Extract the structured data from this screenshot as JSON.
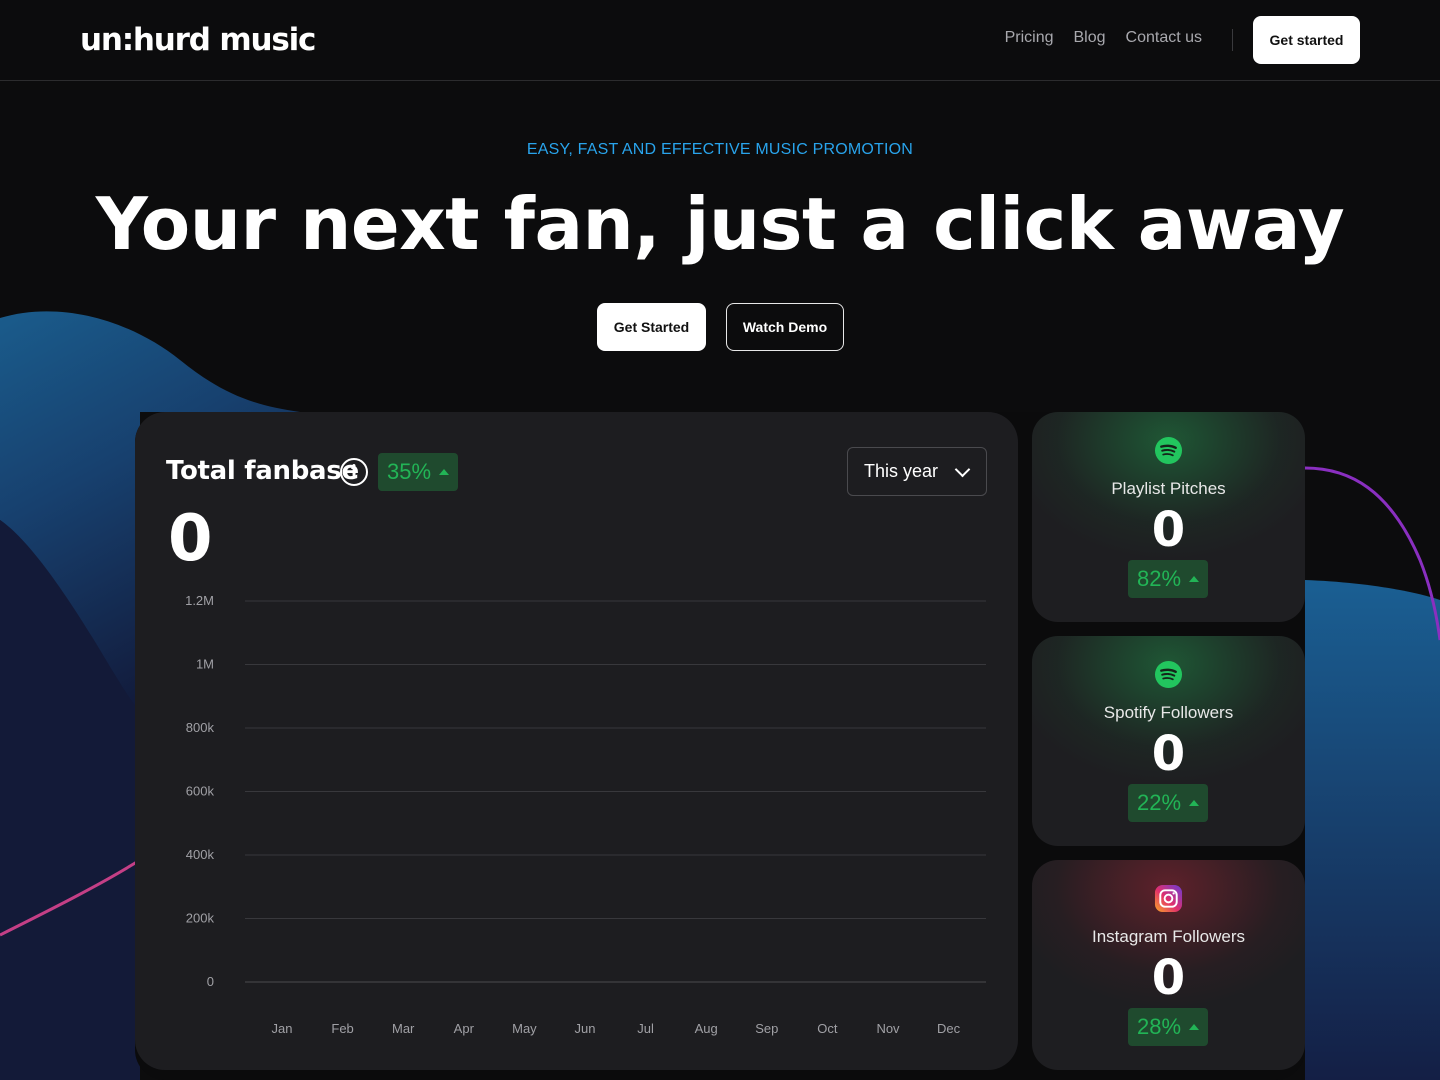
{
  "header": {
    "logo": "un:hurd music",
    "nav": [
      "Pricing",
      "Blog",
      "Contact us"
    ],
    "cta": "Get started"
  },
  "hero": {
    "eyebrow": "EASY, FAST AND EFFECTIVE MUSIC PROMOTION",
    "headline": "Your next fan, just a click away",
    "primary_button": "Get Started",
    "secondary_button": "Watch Demo"
  },
  "fanbase": {
    "title": "Total fanbase",
    "change": "35%",
    "value": "0",
    "period": "This year"
  },
  "chart_data": {
    "type": "line",
    "categories": [
      "Jan",
      "Feb",
      "Mar",
      "Apr",
      "May",
      "Jun",
      "Jul",
      "Aug",
      "Sep",
      "Oct",
      "Nov",
      "Dec"
    ],
    "series": [],
    "yticks": [
      "0",
      "200k",
      "400k",
      "600k",
      "800k",
      "1M",
      "1.2M"
    ],
    "ylim": [
      0,
      1200000
    ],
    "grid": true
  },
  "stats": [
    {
      "label": "Playlist Pitches",
      "value": "0",
      "change": "82%",
      "icon": "spotify-icon"
    },
    {
      "label": "Spotify Followers",
      "value": "0",
      "change": "22%",
      "icon": "spotify-icon"
    },
    {
      "label": "Instagram Followers",
      "value": "0",
      "change": "28%",
      "icon": "instagram-icon"
    }
  ],
  "colors": {
    "accent_blue": "#29a4ec",
    "positive_green": "#22b456",
    "card_bg": "#1d1d20"
  }
}
